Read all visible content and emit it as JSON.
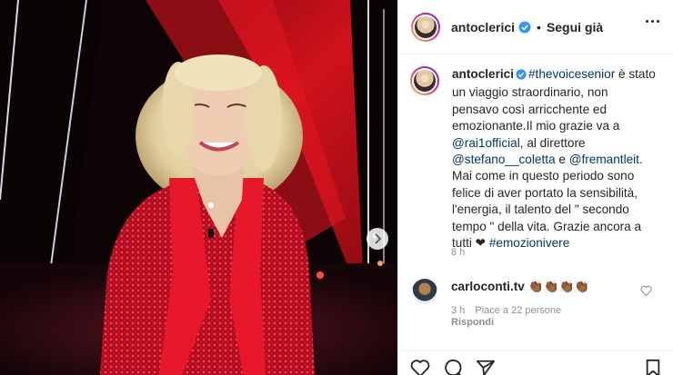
{
  "header": {
    "username": "antoclerici",
    "separator": "•",
    "follow_label": "Segui già"
  },
  "caption": {
    "username": "antoclerici",
    "hashtag1": "#thevoicesenior",
    "text1": " è stato un viaggio straordinario, non pensavo così arricchente ed emozionante.Il mio grazie va a ",
    "mention1": "@rai1official",
    "text2": ", al direttore ",
    "mention2": "@stefano__coletta",
    "text3": " e ",
    "mention3": "@fremantleit",
    "text4": ". Mai come in questo periodo sono felice di aver portato la sensibilità, l'energia, il talento del \" secondo tempo \" della vita. Grazie ancora a tutti ❤ ",
    "hashtag2": "#emozionivere",
    "time": "8 h"
  },
  "comment": {
    "username": "carloconti.tv",
    "text": "👏🏾👏🏾👏🏾👏🏾",
    "time": "3 h",
    "likes": "Piace a 22 persone",
    "reply_label": "Rispondi"
  },
  "icons": {
    "verified": "verified-badge-icon",
    "more": "more-options-icon",
    "next": "chevron-right-icon",
    "like": "heart-icon",
    "comment": "comment-icon",
    "share": "share-icon",
    "save": "bookmark-icon"
  },
  "colors": {
    "verified": "#3897f0",
    "link": "#00376b",
    "muted": "#8e8e8e",
    "dress": "#c8102e"
  }
}
